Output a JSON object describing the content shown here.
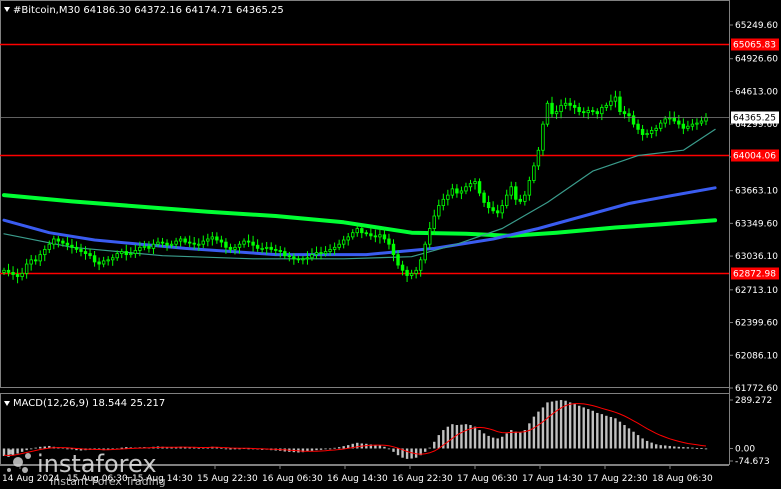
{
  "header": {
    "symbol_line": "#Bitcoin,M30  64186.30 64372.16 64174.71 64365.25",
    "macd_label": "MACD(12,26,9) 18.544 25.217"
  },
  "watermark": {
    "brand": "instaforex",
    "tagline": "Instant Forex Trading"
  },
  "price_axis": {
    "labels": [
      "65249.60",
      "64926.60",
      "64613.00",
      "64299.60",
      "63986.10",
      "63663.10",
      "63349.60",
      "63036.10",
      "62713.10",
      "62399.60",
      "62086.10",
      "61772.60"
    ],
    "current_price": "64365.25"
  },
  "levels": [
    {
      "name": "level-65065",
      "value": 65065.83,
      "label": "65065.83",
      "color": "#ff0000"
    },
    {
      "name": "level-64004",
      "value": 64004.06,
      "label": "64004.06",
      "color": "#ff0000"
    },
    {
      "name": "level-62872",
      "value": 62872.98,
      "label": "62872.98",
      "color": "#ff0000"
    }
  ],
  "macd_axis": {
    "labels": [
      "289.272",
      "0.00",
      "-74.673"
    ]
  },
  "time_axis": {
    "labels": [
      "14 Aug 2024",
      "15 Aug 06:30",
      "15 Aug 14:30",
      "15 Aug 22:30",
      "16 Aug 06:30",
      "16 Aug 14:30",
      "16 Aug 22:30",
      "17 Aug 06:30",
      "17 Aug 14:30",
      "17 Aug 22:30",
      "18 Aug 06:30"
    ]
  },
  "colors": {
    "background": "#000000",
    "candle": "#00ff00",
    "ma_fast": "#3a9c8c",
    "ma_mid": "#3a5cf0",
    "ma_slow": "#00ff33",
    "macd_hist": "#c0c0c0",
    "macd_signal": "#ff0000",
    "level": "#ff0000"
  },
  "chart_data": {
    "type": "candlestick",
    "symbol": "#Bitcoin",
    "timeframe": "M30",
    "ohlc_last": {
      "open": 64186.3,
      "high": 64372.16,
      "low": 64174.71,
      "close": 64365.25
    },
    "ylim": [
      61772.6,
      65249.6
    ],
    "close_series": [
      62900,
      62880,
      62860,
      62840,
      62870,
      62960,
      63000,
      62990,
      63050,
      63100,
      63150,
      63200,
      63180,
      63160,
      63140,
      63120,
      63100,
      63080,
      63060,
      63040,
      62980,
      62960,
      62990,
      63000,
      63020,
      63060,
      63080,
      63050,
      63060,
      63090,
      63120,
      63130,
      63110,
      63150,
      63170,
      63160,
      63140,
      63150,
      63180,
      63200,
      63170,
      63160,
      63150,
      63150,
      63180,
      63200,
      63220,
      63190,
      63170,
      63120,
      63100,
      63120,
      63150,
      63180,
      63170,
      63140,
      63110,
      63110,
      63120,
      63100,
      63090,
      63080,
      63040,
      63030,
      63010,
      63000,
      63010,
      63020,
      63050,
      63070,
      63060,
      63080,
      63100,
      63120,
      63150,
      63190,
      63220,
      63260,
      63300,
      63260,
      63250,
      63230,
      63220,
      63240,
      63200,
      63150,
      63050,
      62950,
      62900,
      62850,
      62870,
      62900,
      63000,
      63150,
      63300,
      63420,
      63520,
      63580,
      63620,
      63680,
      63640,
      63660,
      63700,
      63730,
      63750,
      63640,
      63550,
      63500,
      63470,
      63450,
      63520,
      63620,
      63700,
      63580,
      63560,
      63620,
      63760,
      63900,
      64050,
      64300,
      64500,
      64400,
      64420,
      64480,
      64500,
      64480,
      64460,
      64420,
      64410,
      64430,
      64420,
      64400,
      64460,
      64480,
      64520,
      64560,
      64420,
      64400,
      64380,
      64300,
      64250,
      64200,
      64210,
      64240,
      64260,
      64310,
      64350,
      64360,
      64330,
      64300,
      64260,
      64280,
      64300,
      64310,
      64330,
      64365
    ],
    "moving_averages": [
      {
        "name": "ma-fast",
        "color": "#3a9c8c",
        "width": 1.2,
        "points": [
          [
            0,
            63250
          ],
          [
            15,
            63120
          ],
          [
            35,
            63040
          ],
          [
            55,
            63010
          ],
          [
            75,
            63010
          ],
          [
            90,
            63030
          ],
          [
            100,
            63150
          ],
          [
            110,
            63300
          ],
          [
            120,
            63550
          ],
          [
            130,
            63850
          ],
          [
            140,
            64000
          ],
          [
            150,
            64050
          ],
          [
            157,
            64250
          ]
        ]
      },
      {
        "name": "ma-mid",
        "color": "#3a5cf0",
        "width": 3,
        "points": [
          [
            0,
            63380
          ],
          [
            10,
            63260
          ],
          [
            20,
            63190
          ],
          [
            40,
            63110
          ],
          [
            60,
            63050
          ],
          [
            80,
            63050
          ],
          [
            95,
            63110
          ],
          [
            108,
            63200
          ],
          [
            118,
            63300
          ],
          [
            128,
            63420
          ],
          [
            138,
            63540
          ],
          [
            148,
            63620
          ],
          [
            157,
            63690
          ]
        ]
      },
      {
        "name": "ma-slow",
        "color": "#00ff33",
        "width": 4,
        "points": [
          [
            0,
            63620
          ],
          [
            15,
            63560
          ],
          [
            30,
            63510
          ],
          [
            45,
            63460
          ],
          [
            60,
            63420
          ],
          [
            75,
            63360
          ],
          [
            90,
            63260
          ],
          [
            102,
            63250
          ],
          [
            112,
            63230
          ],
          [
            122,
            63260
          ],
          [
            135,
            63310
          ],
          [
            145,
            63340
          ],
          [
            157,
            63380
          ]
        ]
      }
    ],
    "macd": {
      "ylim": [
        -74.673,
        289.272
      ],
      "histogram": [
        -45,
        -50,
        -40,
        -30,
        -20,
        -10,
        0,
        5,
        10,
        12,
        15,
        10,
        8,
        5,
        0,
        -5,
        -10,
        -12,
        -10,
        -8,
        -5,
        -8,
        -10,
        -8,
        -5,
        0,
        5,
        8,
        6,
        5,
        7,
        8,
        6,
        10,
        12,
        10,
        8,
        6,
        8,
        10,
        8,
        6,
        5,
        4,
        6,
        8,
        10,
        7,
        4,
        -2,
        -6,
        -4,
        -2,
        2,
        0,
        -3,
        -6,
        -8,
        -7,
        -10,
        -12,
        -14,
        -18,
        -20,
        -22,
        -24,
        -22,
        -18,
        -14,
        -10,
        -8,
        -4,
        0,
        4,
        8,
        14,
        20,
        28,
        34,
        30,
        28,
        24,
        20,
        18,
        10,
        0,
        -20,
        -40,
        -55,
        -62,
        -60,
        -55,
        -40,
        -20,
        5,
        40,
        80,
        110,
        130,
        145,
        140,
        142,
        145,
        140,
        130,
        110,
        90,
        75,
        65,
        60,
        70,
        90,
        110,
        100,
        95,
        110,
        150,
        190,
        220,
        245,
        275,
        280,
        285,
        289,
        285,
        275,
        265,
        255,
        245,
        235,
        225,
        212,
        205,
        195,
        188,
        180,
        160,
        140,
        120,
        100,
        80,
        60,
        45,
        35,
        25,
        20,
        18,
        15,
        12,
        10,
        8,
        7,
        5,
        3,
        2,
        0
      ],
      "signal": [
        -40,
        -42,
        -40,
        -36,
        -30,
        -24,
        -18,
        -12,
        -6,
        -2,
        2,
        4,
        5,
        5,
        4,
        2,
        0,
        -2,
        -4,
        -5,
        -6,
        -6,
        -7,
        -7,
        -6,
        -5,
        -3,
        -1,
        0,
        1,
        2,
        3,
        4,
        5,
        6,
        7,
        7,
        7,
        7,
        8,
        8,
        7,
        7,
        6,
        6,
        6,
        7,
        7,
        6,
        5,
        3,
        2,
        1,
        1,
        1,
        0,
        -1,
        -2,
        -3,
        -4,
        -5,
        -7,
        -8,
        -10,
        -12,
        -14,
        -16,
        -17,
        -17,
        -16,
        -15,
        -13,
        -11,
        -9,
        -6,
        -3,
        1,
        5,
        10,
        14,
        17,
        19,
        20,
        20,
        19,
        16,
        10,
        2,
        -8,
        -18,
        -26,
        -32,
        -34,
        -32,
        -26,
        -15,
        0,
        20,
        40,
        60,
        80,
        95,
        108,
        118,
        124,
        126,
        124,
        118,
        110,
        100,
        95,
        94,
        96,
        97,
        98,
        100,
        108,
        122,
        140,
        160,
        182,
        204,
        224,
        242,
        256,
        264,
        268,
        268,
        266,
        262,
        256,
        248,
        240,
        232,
        224,
        216,
        206,
        194,
        180,
        165,
        150,
        134,
        118,
        104,
        90,
        78,
        68,
        58,
        50,
        42,
        36,
        30,
        26,
        22,
        18,
        15
      ]
    }
  }
}
